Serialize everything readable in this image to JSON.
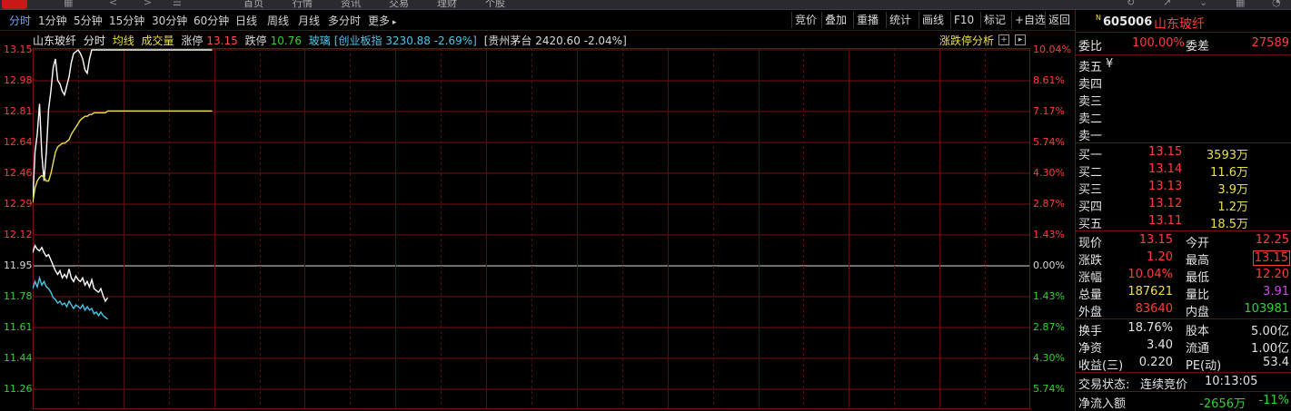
{
  "topbar": {
    "menu": [
      "首页",
      "行情",
      "资讯",
      "交易",
      "理财",
      "个股"
    ]
  },
  "tabs": [
    "分时",
    "1分钟",
    "5分钟",
    "15分钟",
    "30分钟",
    "60分钟",
    "日线",
    "周线",
    "月线",
    "多分时",
    "更多"
  ],
  "toolbar": [
    "竞价",
    "叠加",
    "重播",
    "统计",
    "画线",
    "F10",
    "标记",
    "+自选",
    "返回"
  ],
  "chart_header": {
    "name": "山东玻纤",
    "fenshi": "分时",
    "avg_line": "均线",
    "volume": "成交量",
    "limit_up_label": "涨停",
    "limit_up_value": "13.15",
    "limit_down_label": "跌停",
    "limit_down_value": "10.76",
    "sector": "玻璃",
    "index1": "[创业板指 3230.88 -2.69%]",
    "index2": "[贵州茅台 2420.60 -2.04%]",
    "analysis": "涨跌停分析",
    "btn_plus": "+",
    "btn_next": "▸"
  },
  "y_axis_left": [
    "13.15",
    "12.98",
    "12.81",
    "12.64",
    "12.46",
    "12.29",
    "12.12",
    "11.95",
    "11.78",
    "11.61",
    "11.44",
    "11.26"
  ],
  "y_axis_right": [
    "10.04%",
    "8.61%",
    "7.17%",
    "5.74%",
    "4.30%",
    "2.87%",
    "1.43%",
    "0.00%",
    "1.43%",
    "2.87%",
    "4.30%",
    "5.74%"
  ],
  "chart_data": {
    "type": "line",
    "ylim": [
      11.26,
      13.15
    ],
    "prev_close": 11.95,
    "series": [
      {
        "color": "#ffffff",
        "values": [
          12.3,
          12.58,
          12.68,
          12.85,
          12.57,
          12.42,
          12.58,
          12.82,
          12.92,
          13.05,
          13.1,
          12.98,
          12.96,
          12.92,
          12.9,
          12.95,
          13.0,
          13.08,
          13.13,
          13.14,
          13.15,
          13.13,
          13.1,
          13.04,
          13.02,
          13.1,
          13.15,
          13.15,
          13.15,
          13.15,
          13.15,
          13.15,
          13.15,
          13.15,
          13.15,
          13.15,
          13.15,
          13.15,
          13.15,
          13.15,
          13.15,
          13.15,
          13.15,
          13.15,
          13.15,
          13.15,
          13.15,
          13.15,
          13.15,
          13.15,
          13.15,
          13.15,
          13.15,
          13.15,
          13.15,
          13.15,
          13.15,
          13.15,
          13.15,
          13.15,
          13.15,
          13.15,
          13.15,
          13.15,
          13.15,
          13.15,
          13.15,
          13.15,
          13.15,
          13.15,
          13.15,
          13.15,
          13.15,
          13.15,
          13.15,
          13.15,
          13.15,
          13.15,
          13.15,
          13.15
        ]
      },
      {
        "color": "#e8e04a",
        "values": [
          12.3,
          12.38,
          12.42,
          12.44,
          12.45,
          12.44,
          12.42,
          12.42,
          12.46,
          12.52,
          12.58,
          12.61,
          12.62,
          12.63,
          12.63,
          12.64,
          12.65,
          12.68,
          12.7,
          12.72,
          12.74,
          12.76,
          12.77,
          12.78,
          12.78,
          12.79,
          12.79,
          12.8,
          12.8,
          12.8,
          12.8,
          12.8,
          12.8,
          12.81,
          12.81,
          12.81,
          12.81,
          12.81,
          12.81,
          12.81,
          12.81,
          12.81,
          12.81,
          12.81,
          12.81,
          12.81,
          12.81,
          12.81,
          12.81,
          12.81,
          12.81,
          12.81,
          12.81,
          12.81,
          12.81,
          12.81,
          12.81,
          12.81,
          12.81,
          12.81,
          12.81,
          12.81,
          12.81,
          12.81,
          12.81,
          12.81,
          12.81,
          12.81,
          12.81,
          12.81,
          12.81,
          12.81,
          12.81,
          12.81,
          12.81,
          12.81,
          12.81,
          12.81,
          12.81,
          12.81
        ]
      },
      {
        "color": "#ffffff",
        "values": [
          12.02,
          12.06,
          12.04,
          12.03,
          12.05,
          12.02,
          12.0,
          12.01,
          11.98,
          11.95,
          11.92,
          11.9,
          11.92,
          11.88,
          11.9,
          11.88,
          11.93,
          11.88,
          11.86,
          11.89,
          11.87,
          11.86,
          11.88,
          11.84,
          11.86,
          11.83,
          11.87,
          11.82,
          11.81,
          11.8,
          11.82,
          11.78,
          11.75,
          11.77
        ]
      },
      {
        "color": "#4ec6e6",
        "values": [
          11.82,
          11.86,
          11.83,
          11.88,
          11.84,
          11.86,
          11.83,
          11.82,
          11.8,
          11.77,
          11.76,
          11.74,
          11.75,
          11.73,
          11.74,
          11.72,
          11.75,
          11.73,
          11.71,
          11.73,
          11.72,
          11.71,
          11.73,
          11.7,
          11.72,
          11.7,
          11.71,
          11.68,
          11.69,
          11.67,
          11.69,
          11.67,
          11.66,
          11.65
        ]
      }
    ]
  },
  "right_panel": {
    "badge": "N",
    "code": "605006",
    "name": "山东玻纤",
    "webi_label": "委比",
    "webi_value": "100.00%",
    "weicha_label": "委差",
    "weicha_value": "27589",
    "sell": [
      {
        "label": "卖五",
        "extra": "¥"
      },
      {
        "label": "卖四",
        "extra": ""
      },
      {
        "label": "卖三",
        "extra": ""
      },
      {
        "label": "卖二",
        "extra": ""
      },
      {
        "label": "卖一",
        "extra": ""
      }
    ],
    "buy": [
      {
        "label": "买一",
        "price": "13.15",
        "vol": "3593万"
      },
      {
        "label": "买二",
        "price": "13.14",
        "vol": "11.6万"
      },
      {
        "label": "买三",
        "price": "13.13",
        "vol": "3.9万"
      },
      {
        "label": "买四",
        "price": "13.12",
        "vol": "1.2万"
      },
      {
        "label": "买五",
        "price": "13.11",
        "vol": "18.5万"
      }
    ],
    "stats": [
      {
        "l1": "现价",
        "v1": "13.15",
        "l2": "今开",
        "v2": "12.25"
      },
      {
        "l1": "涨跌",
        "v1": "1.20",
        "l2": "最高",
        "v2": "13.15"
      },
      {
        "l1": "涨幅",
        "v1": "10.04%",
        "l2": "最低",
        "v2": "12.20"
      },
      {
        "l1": "总量",
        "v1": "187621",
        "l2": "量比",
        "v2": "3.91"
      },
      {
        "l1": "外盘",
        "v1": "83640",
        "l2": "内盘",
        "v2": "103981"
      }
    ],
    "fund": [
      {
        "l1": "换手",
        "v1": "18.76%",
        "l2": "股本",
        "v2": "5.00亿"
      },
      {
        "l1": "净资",
        "v1": "3.40",
        "l2": "流通",
        "v2": "1.00亿"
      },
      {
        "l1": "收益(三)",
        "v1": "0.220",
        "l2": "PE(动)",
        "v2": "53.4"
      }
    ],
    "trade_status_label": "交易状态:",
    "trade_status": "连续竞价",
    "time": "10:13:05",
    "net_inflow_label": "净流入额",
    "net_inflow": "-2656万",
    "net_inflow_pct": "-11%"
  }
}
